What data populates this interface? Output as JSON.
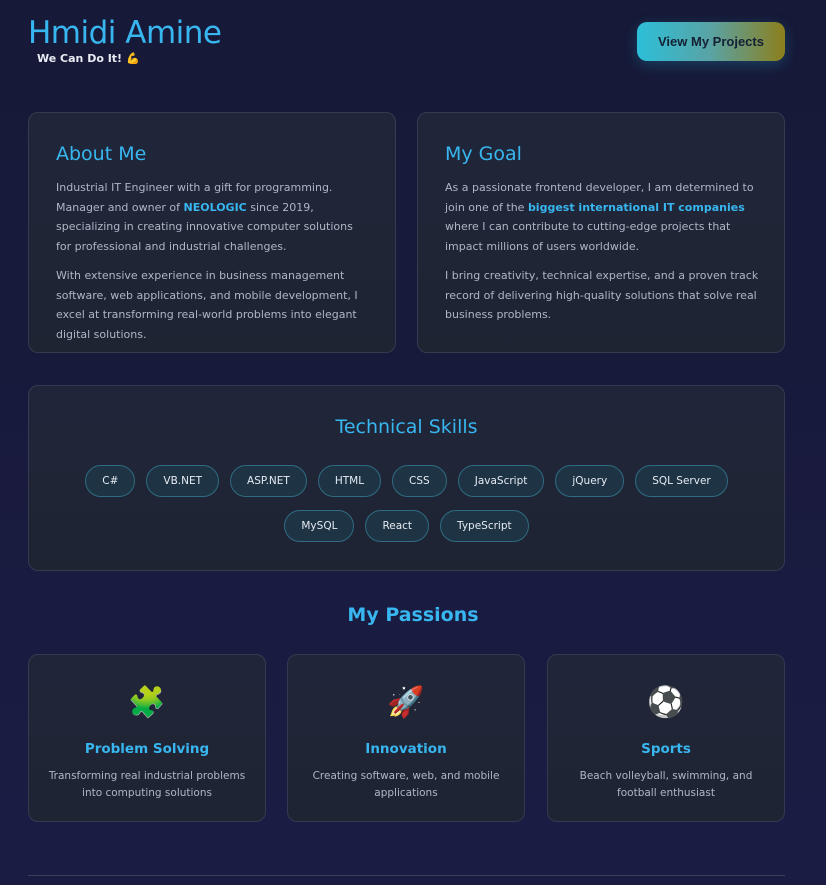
{
  "header": {
    "name": "Hmidi Amine",
    "tagline": "We Can Do It!",
    "tagline_icon": "flexed-biceps-icon",
    "cta_label": "View My Projects"
  },
  "about": {
    "title": "About Me",
    "p1_a": "Industrial IT Engineer with a gift for programming. Manager and owner of ",
    "p1_highlight": "NEOLOGIC",
    "p1_b": " since 2019, specializing in creating innovative computer solutions for professional and industrial challenges.",
    "p2": "With extensive experience in business management software, web applications, and mobile development, I excel at transforming real-world problems into elegant digital solutions."
  },
  "goal": {
    "title": "My Goal",
    "p1_a": "As a passionate frontend developer, I am determined to join one of the ",
    "p1_highlight": "biggest international IT companies",
    "p1_b": " where I can contribute to cutting-edge projects that impact millions of users worldwide.",
    "p2": "I bring creativity, technical expertise, and a proven track record of delivering high-quality solutions that solve real business problems."
  },
  "skills": {
    "title": "Technical Skills",
    "items": [
      "C#",
      "VB.NET",
      "ASP.NET",
      "HTML",
      "CSS",
      "JavaScript",
      "jQuery",
      "SQL Server",
      "MySQL",
      "React",
      "TypeScript"
    ]
  },
  "passions": {
    "title": "My Passions",
    "items": [
      {
        "icon": "puzzle-icon",
        "title": "Problem Solving",
        "desc": "Transforming real industrial problems into computing solutions"
      },
      {
        "icon": "rocket-icon",
        "title": "Innovation",
        "desc": "Creating software, web, and mobile applications"
      },
      {
        "icon": "soccer-ball-icon",
        "title": "Sports",
        "desc": "Beach volleyball, swimming, and football enthusiast"
      }
    ]
  },
  "colors": {
    "accent": "#38b6ef",
    "background": "#181a3a",
    "card": "#20263a",
    "chip_border": "#2f6b82"
  }
}
